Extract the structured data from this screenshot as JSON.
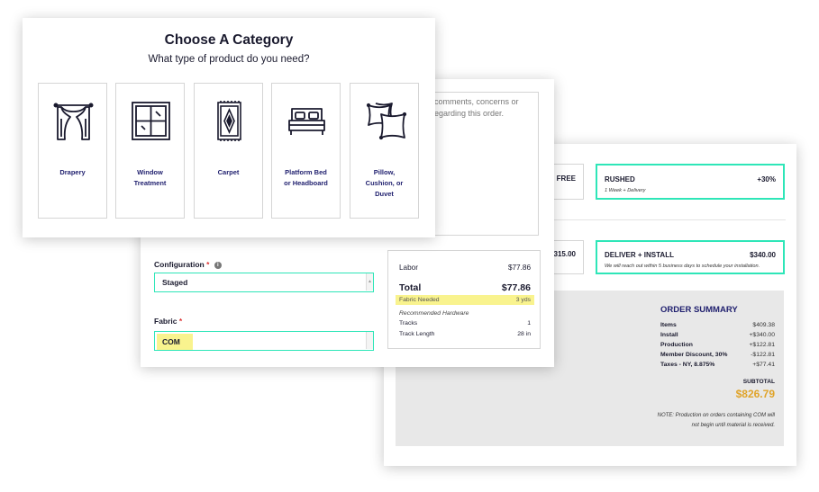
{
  "category": {
    "title": "Choose A Category",
    "subtitle": "What type of product do you need?",
    "items": [
      {
        "label": "Drapery",
        "icon": "drapery-icon"
      },
      {
        "label": "Window\nTreatment",
        "icon": "window-icon"
      },
      {
        "label": "Carpet",
        "icon": "carpet-icon"
      },
      {
        "label": "Platform Bed\nor Headboard",
        "icon": "bed-icon"
      },
      {
        "label": "Pillow,\nCushion, or\nDuvet",
        "icon": "pillow-icon"
      }
    ]
  },
  "form": {
    "comments_placeholder": "comments, concerns or\negarding this order.",
    "configuration": {
      "label": "Configuration",
      "required_mark": "*",
      "value": "Staged"
    },
    "fabric": {
      "label": "Fabric",
      "required_mark": "*",
      "value": "COM"
    }
  },
  "pricing": {
    "labor_label": "Labor",
    "labor_value": "$77.86",
    "total_label": "Total",
    "total_value": "$77.86",
    "fabric_needed_label": "Fabric Needed",
    "fabric_needed_value": "3 yds",
    "hardware_title": "Recommended Hardware",
    "tracks_label": "Tracks",
    "tracks_value": "1",
    "track_length_label": "Track Length",
    "track_length_value": "28 in"
  },
  "options": {
    "free_label": "FREE",
    "rushed_title": "RUSHED",
    "rushed_price": "+30%",
    "rushed_sub": "1 Week + Delivery",
    "partial_price": "315.00",
    "deliver_title": "DELIVER + INSTALL",
    "deliver_price": "$340.00",
    "deliver_sub": "We will reach out within 5 business days to schedule your installation."
  },
  "summary": {
    "title": "ORDER SUMMARY",
    "rows": [
      {
        "label": "Items",
        "value": "$409.38"
      },
      {
        "label": "Install",
        "value": "+$340.00"
      },
      {
        "label": "Production",
        "value": "+$122.81"
      },
      {
        "label": "Member Discount, 30%",
        "value": "-$122.81"
      },
      {
        "label": "Taxes - NY, 8.875%",
        "value": "+$77.41"
      }
    ],
    "subtotal_label": "SUBTOTAL",
    "subtotal_value": "$826.79",
    "note": "NOTE: Production on orders containing COM will not begin until material is received."
  },
  "colors": {
    "accent": "#2ee6b8",
    "highlight": "#f9f38e",
    "price": "#e0a42a",
    "navy": "#1f1f6e"
  }
}
